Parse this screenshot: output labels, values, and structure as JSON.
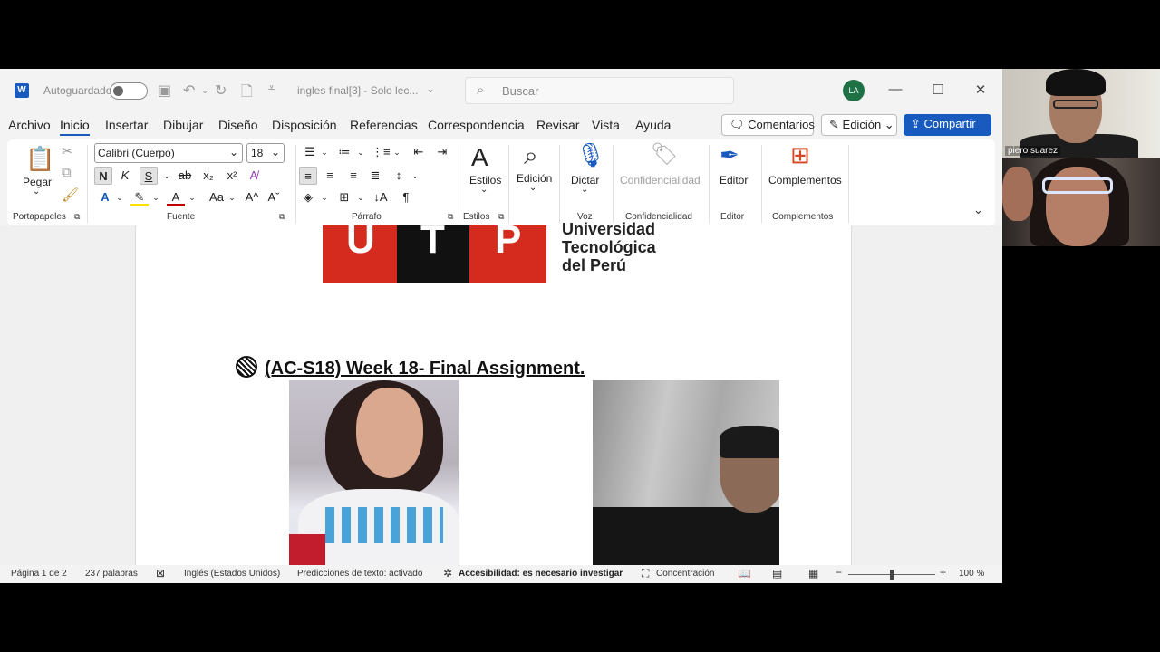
{
  "titlebar": {
    "autosave_label": "Autoguardado",
    "document_title": "ingles final[3]  -  Solo lec...",
    "search_placeholder": "Buscar",
    "user_initials": "LA"
  },
  "menu": {
    "tabs": [
      "Archivo",
      "Inicio",
      "Insertar",
      "Dibujar",
      "Diseño",
      "Disposición",
      "Referencias",
      "Correspondencia",
      "Revisar",
      "Vista",
      "Ayuda"
    ],
    "active_tab": "Inicio",
    "comments_label": "Comentarios",
    "editing_label": "Edición",
    "share_label": "Compartir"
  },
  "ribbon": {
    "paste_label": "Pegar",
    "font_name": "Calibri (Cuerpo)",
    "font_size": "18",
    "bold": "N",
    "italic": "K",
    "underline": "S",
    "styles_label": "Estilos",
    "editing_label": "Edición",
    "dictate_label": "Dictar",
    "sensitivity_label": "Confidencialidad",
    "editor_label": "Editor",
    "addins_label": "Complementos",
    "groups": {
      "clipboard": "Portapapeles",
      "font": "Fuente",
      "paragraph": "Párrafo",
      "styles": "Estilos",
      "voice": "Voz",
      "sensitivity": "Confidencialidad",
      "editor": "Editor",
      "addins": "Complementos"
    }
  },
  "document": {
    "logo_letters": [
      "U",
      "T",
      "P"
    ],
    "logo_name_lines": [
      "Universidad",
      "Tecnológica",
      "del Perú"
    ],
    "heading": "(AC-S18) Week 18- Final Assignment."
  },
  "status": {
    "page": "Página 1 de 2",
    "words": "237 palabras",
    "language": "Inglés (Estados Unidos)",
    "predictions": "Predicciones de texto: activado",
    "accessibility": "Accesibilidad: es necesario investigar",
    "focus": "Concentración",
    "zoom": "100 %"
  },
  "video_call": {
    "participant_1": "piero suarez"
  },
  "colors": {
    "word_blue": "#185abd",
    "utp_red": "#d52b1e",
    "avatar_green": "#1e7145"
  }
}
